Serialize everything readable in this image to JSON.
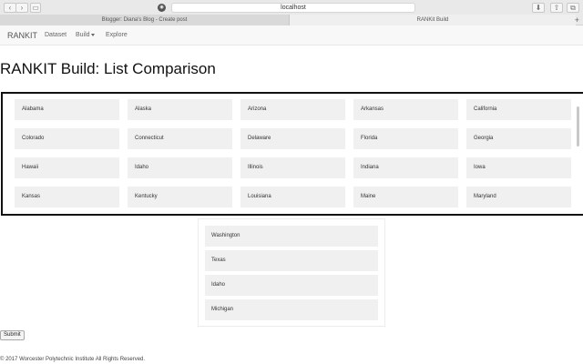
{
  "browser": {
    "address": "localhost",
    "tabs": [
      {
        "label": "Blogger: Diana's Blog - Create post",
        "active": false
      },
      {
        "label": "RANKit Build",
        "active": true
      }
    ]
  },
  "navbar": {
    "brand": "RANKIT",
    "links": [
      {
        "label": "Dataset",
        "dropdown": false
      },
      {
        "label": "Build",
        "dropdown": true
      },
      {
        "label": "Explore",
        "dropdown": false
      }
    ]
  },
  "page": {
    "title": "RANKIT Build: List Comparison"
  },
  "source_list": [
    "Alabama",
    "Alaska",
    "Arizona",
    "Arkansas",
    "California",
    "Colorado",
    "Connecticut",
    "Delaware",
    "Florida",
    "Georgia",
    "Hawaii",
    "Idaho",
    "Illinois",
    "Indiana",
    "Iowa",
    "Kansas",
    "Kentucky",
    "Louisiana",
    "Maine",
    "Maryland"
  ],
  "target_list": [
    "Washington",
    "Texas",
    "Idaho",
    "Michigan"
  ],
  "submit_label": "Submit",
  "footer": "© 2017 Worcester Polytechnic Institute All Rights Reserved."
}
